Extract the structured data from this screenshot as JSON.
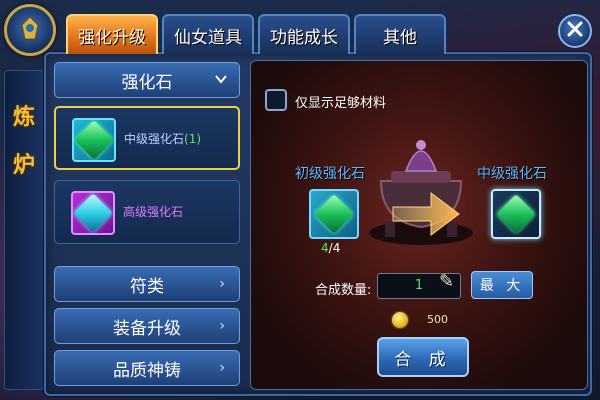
{
  "tabs": [
    {
      "label": "强化升级",
      "active": true
    },
    {
      "label": "仙女道具",
      "active": false
    },
    {
      "label": "功能成长",
      "active": false
    },
    {
      "label": "其他",
      "active": false
    }
  ],
  "side_banner": {
    "chars": [
      "炼",
      "炉"
    ]
  },
  "left_panel": {
    "category": "强化石",
    "items": [
      {
        "name": "中级强化石",
        "qty": "(1)",
        "rarity": "green",
        "selected": true
      },
      {
        "name": "高级强化石",
        "qty": "",
        "rarity": "purple",
        "selected": false
      }
    ],
    "buttons": [
      "符类",
      "装备升级",
      "品质神铸"
    ]
  },
  "right_panel": {
    "checkbox_label": "仅显示足够材料",
    "checkbox_checked": false,
    "source": {
      "label": "初级强化石",
      "have": "4",
      "need": "4"
    },
    "target": {
      "label": "中级强化石"
    },
    "quantity_label": "合成数量:",
    "quantity_value": "1",
    "max_button": "最 大",
    "cost": "500",
    "compose_button": "合 成"
  },
  "colors": {
    "active_tab": "#e0701b",
    "frame_blue": "#3d6aa7",
    "green_text": "#59e36a",
    "purple_text": "#e07cff",
    "slot_label": "#5cb6ff"
  },
  "icons": [
    "emblem-icon",
    "close-icon",
    "chevron-down-icon",
    "chevron-right-icon",
    "gem-icon",
    "arrow-right-icon",
    "feather-icon",
    "coin-icon"
  ]
}
